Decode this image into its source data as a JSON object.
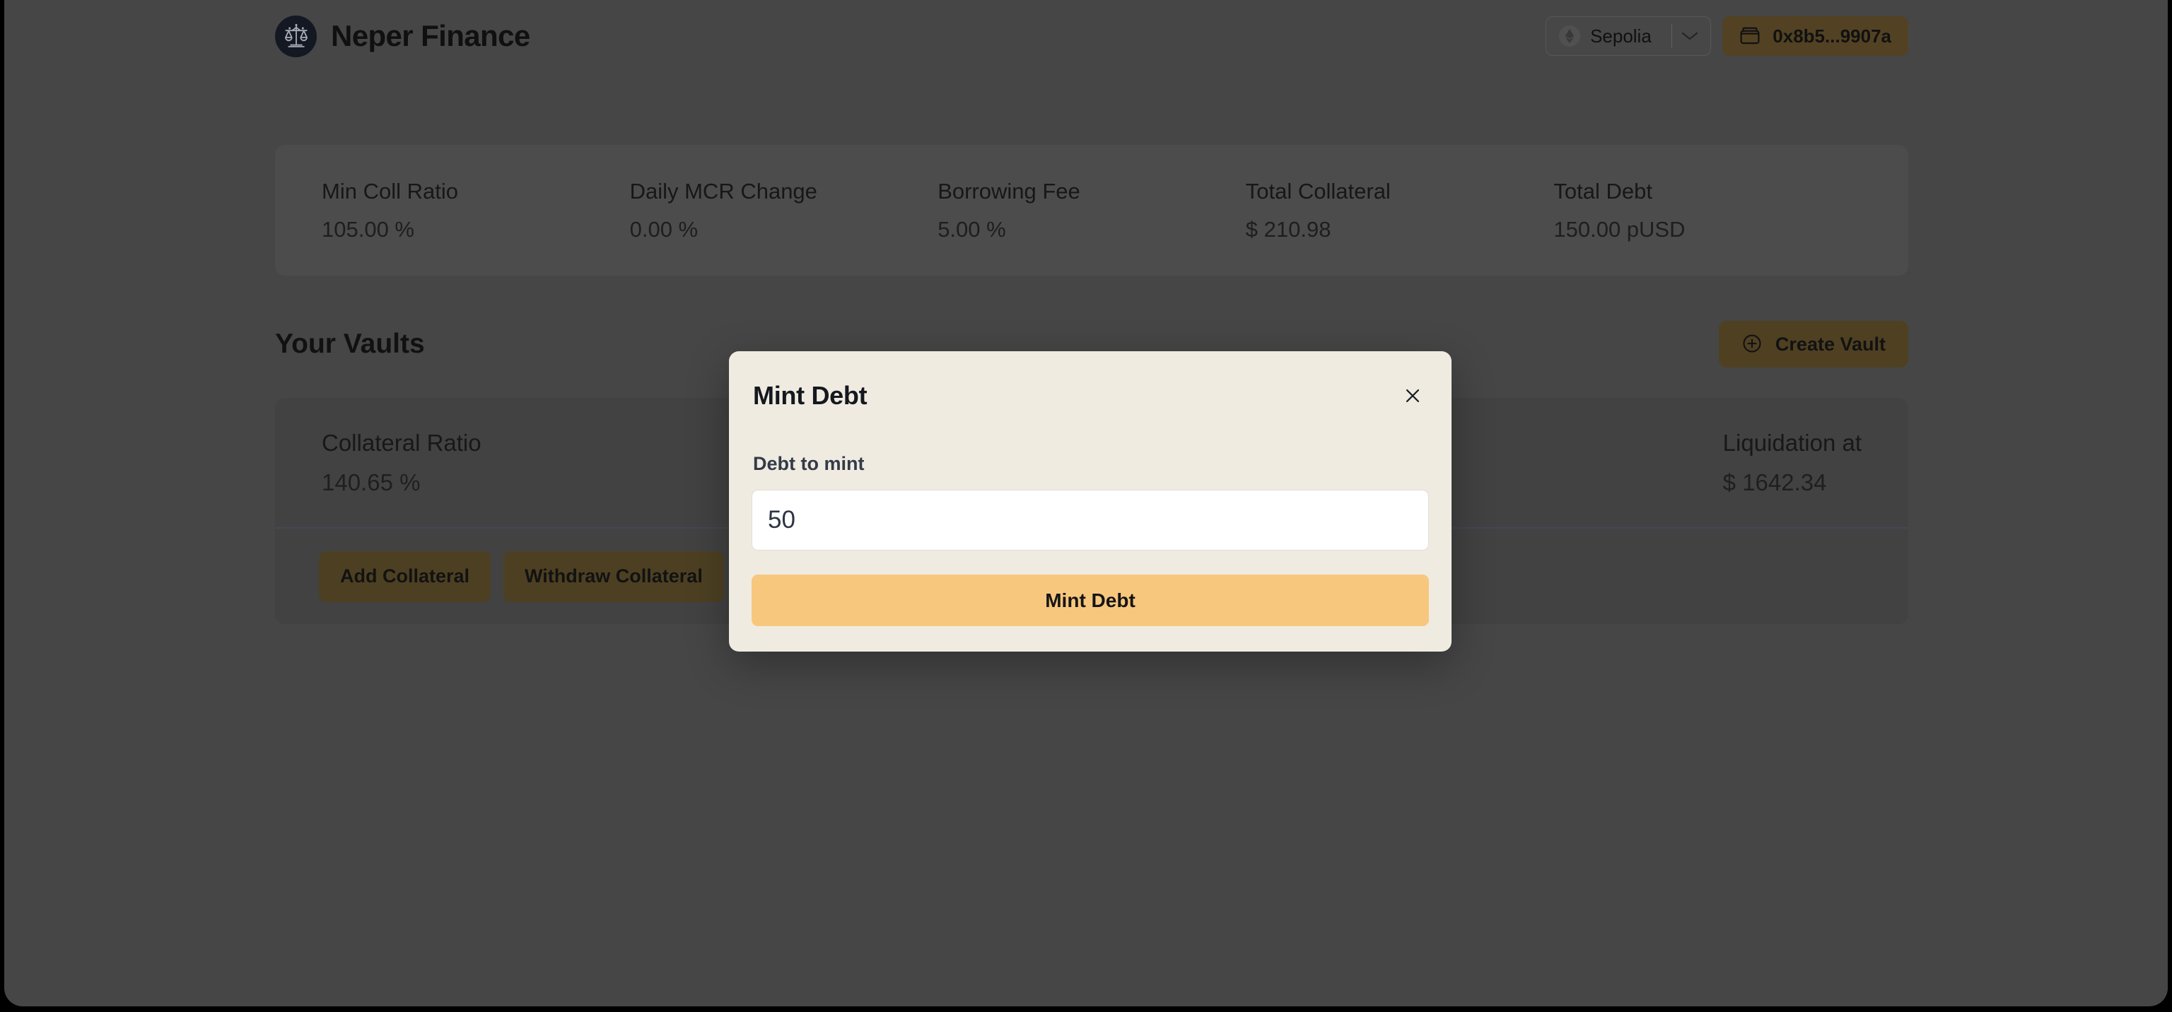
{
  "header": {
    "brand_title": "Neper Finance",
    "logo_icon": "scales-of-justice-icon",
    "network": {
      "icon": "ethereum-icon",
      "label": "Sepolia",
      "chevron_icon": "chevron-down-icon"
    },
    "wallet": {
      "icon": "wallet-icon",
      "address": "0x8b5...9907a"
    }
  },
  "stats": [
    {
      "label": "Min Coll Ratio",
      "value": "105.00 %"
    },
    {
      "label": "Daily MCR Change",
      "value": "0.00 %"
    },
    {
      "label": "Borrowing Fee",
      "value": "5.00 %"
    },
    {
      "label": "Total Collateral",
      "value": "$ 210.98"
    },
    {
      "label": "Total Debt",
      "value": "150.00 pUSD"
    }
  ],
  "vaults_section": {
    "title": "Your Vaults",
    "create_vault_label": "Create Vault",
    "create_vault_icon": "plus-circle-icon"
  },
  "vault": {
    "collateral_ratio_label": "Collateral Ratio",
    "collateral_ratio_value": "140.65 %",
    "liquidation_label": "Liquidation at",
    "liquidation_value": "$ 1642.34",
    "actions": [
      {
        "label": "Add Collateral"
      },
      {
        "label": "Withdraw Collateral"
      }
    ]
  },
  "modal": {
    "title": "Mint Debt",
    "close_icon": "close-icon",
    "field_label": "Debt to mint",
    "input_value": "50",
    "input_placeholder": "0.0",
    "submit_label": "Mint Debt"
  },
  "colors": {
    "page_background": "#4e4e4e",
    "card_background": "#555555",
    "vault_card_background": "#4a4a4a",
    "accent_brown": "#584826",
    "modal_background": "#efebe0",
    "primary_button": "#f8c77e",
    "text_dark": "#141414",
    "label_slate": "#333b48"
  }
}
